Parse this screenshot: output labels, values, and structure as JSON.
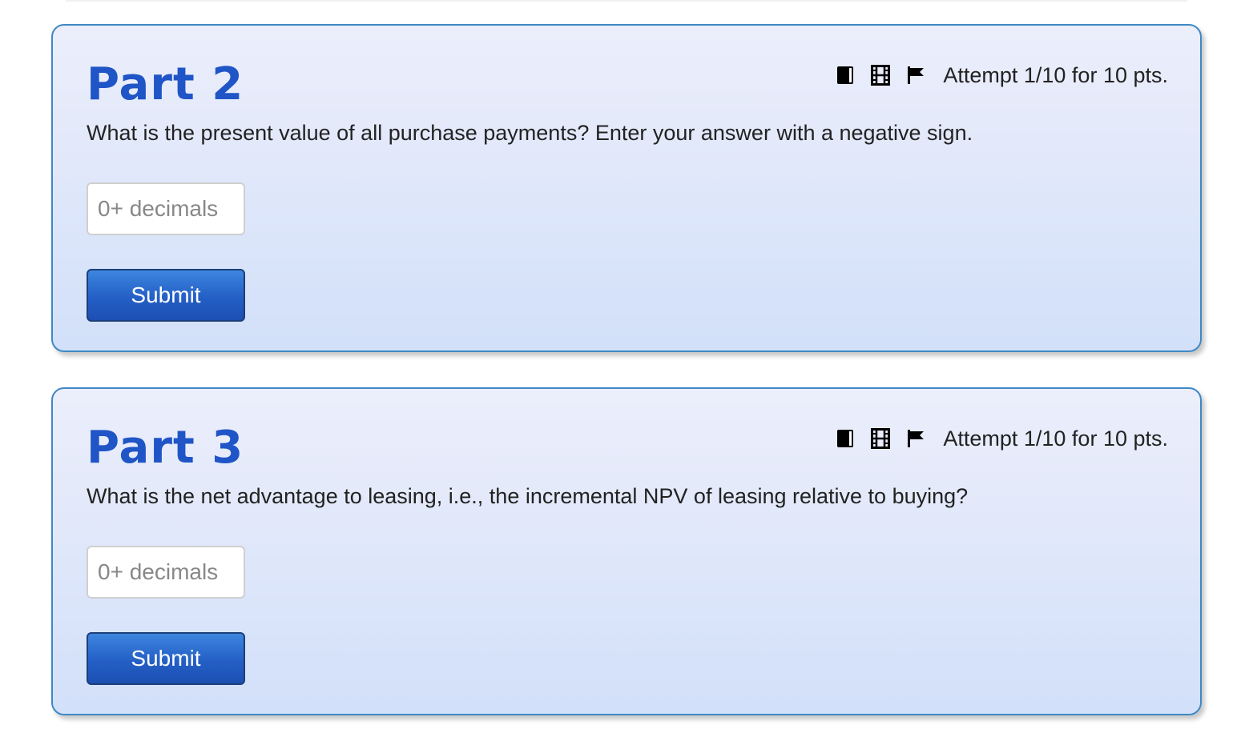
{
  "parts": [
    {
      "title": "Part 2",
      "attempt": "Attempt 1/10 for 10 pts.",
      "question": "What is the present value of all purchase payments? Enter your answer with a negative sign.",
      "input": {
        "placeholder": "0+ decimals",
        "value": ""
      },
      "submit_label": "Submit",
      "icons": [
        "book-icon",
        "film-icon",
        "flag-icon"
      ]
    },
    {
      "title": "Part 3",
      "attempt": "Attempt 1/10 for 10 pts.",
      "question": "What is the net advantage to leasing, i.e., the incremental NPV of leasing relative to buying?",
      "input": {
        "placeholder": "0+ decimals",
        "value": ""
      },
      "submit_label": "Submit",
      "icons": [
        "book-icon",
        "film-icon",
        "flag-icon"
      ]
    }
  ],
  "colors": {
    "title": "#1f55c6",
    "card_border": "#3f88c5",
    "card_bg_top": "#eceefb",
    "card_bg_bottom": "#d2e0f9",
    "button": "#245fc6"
  }
}
